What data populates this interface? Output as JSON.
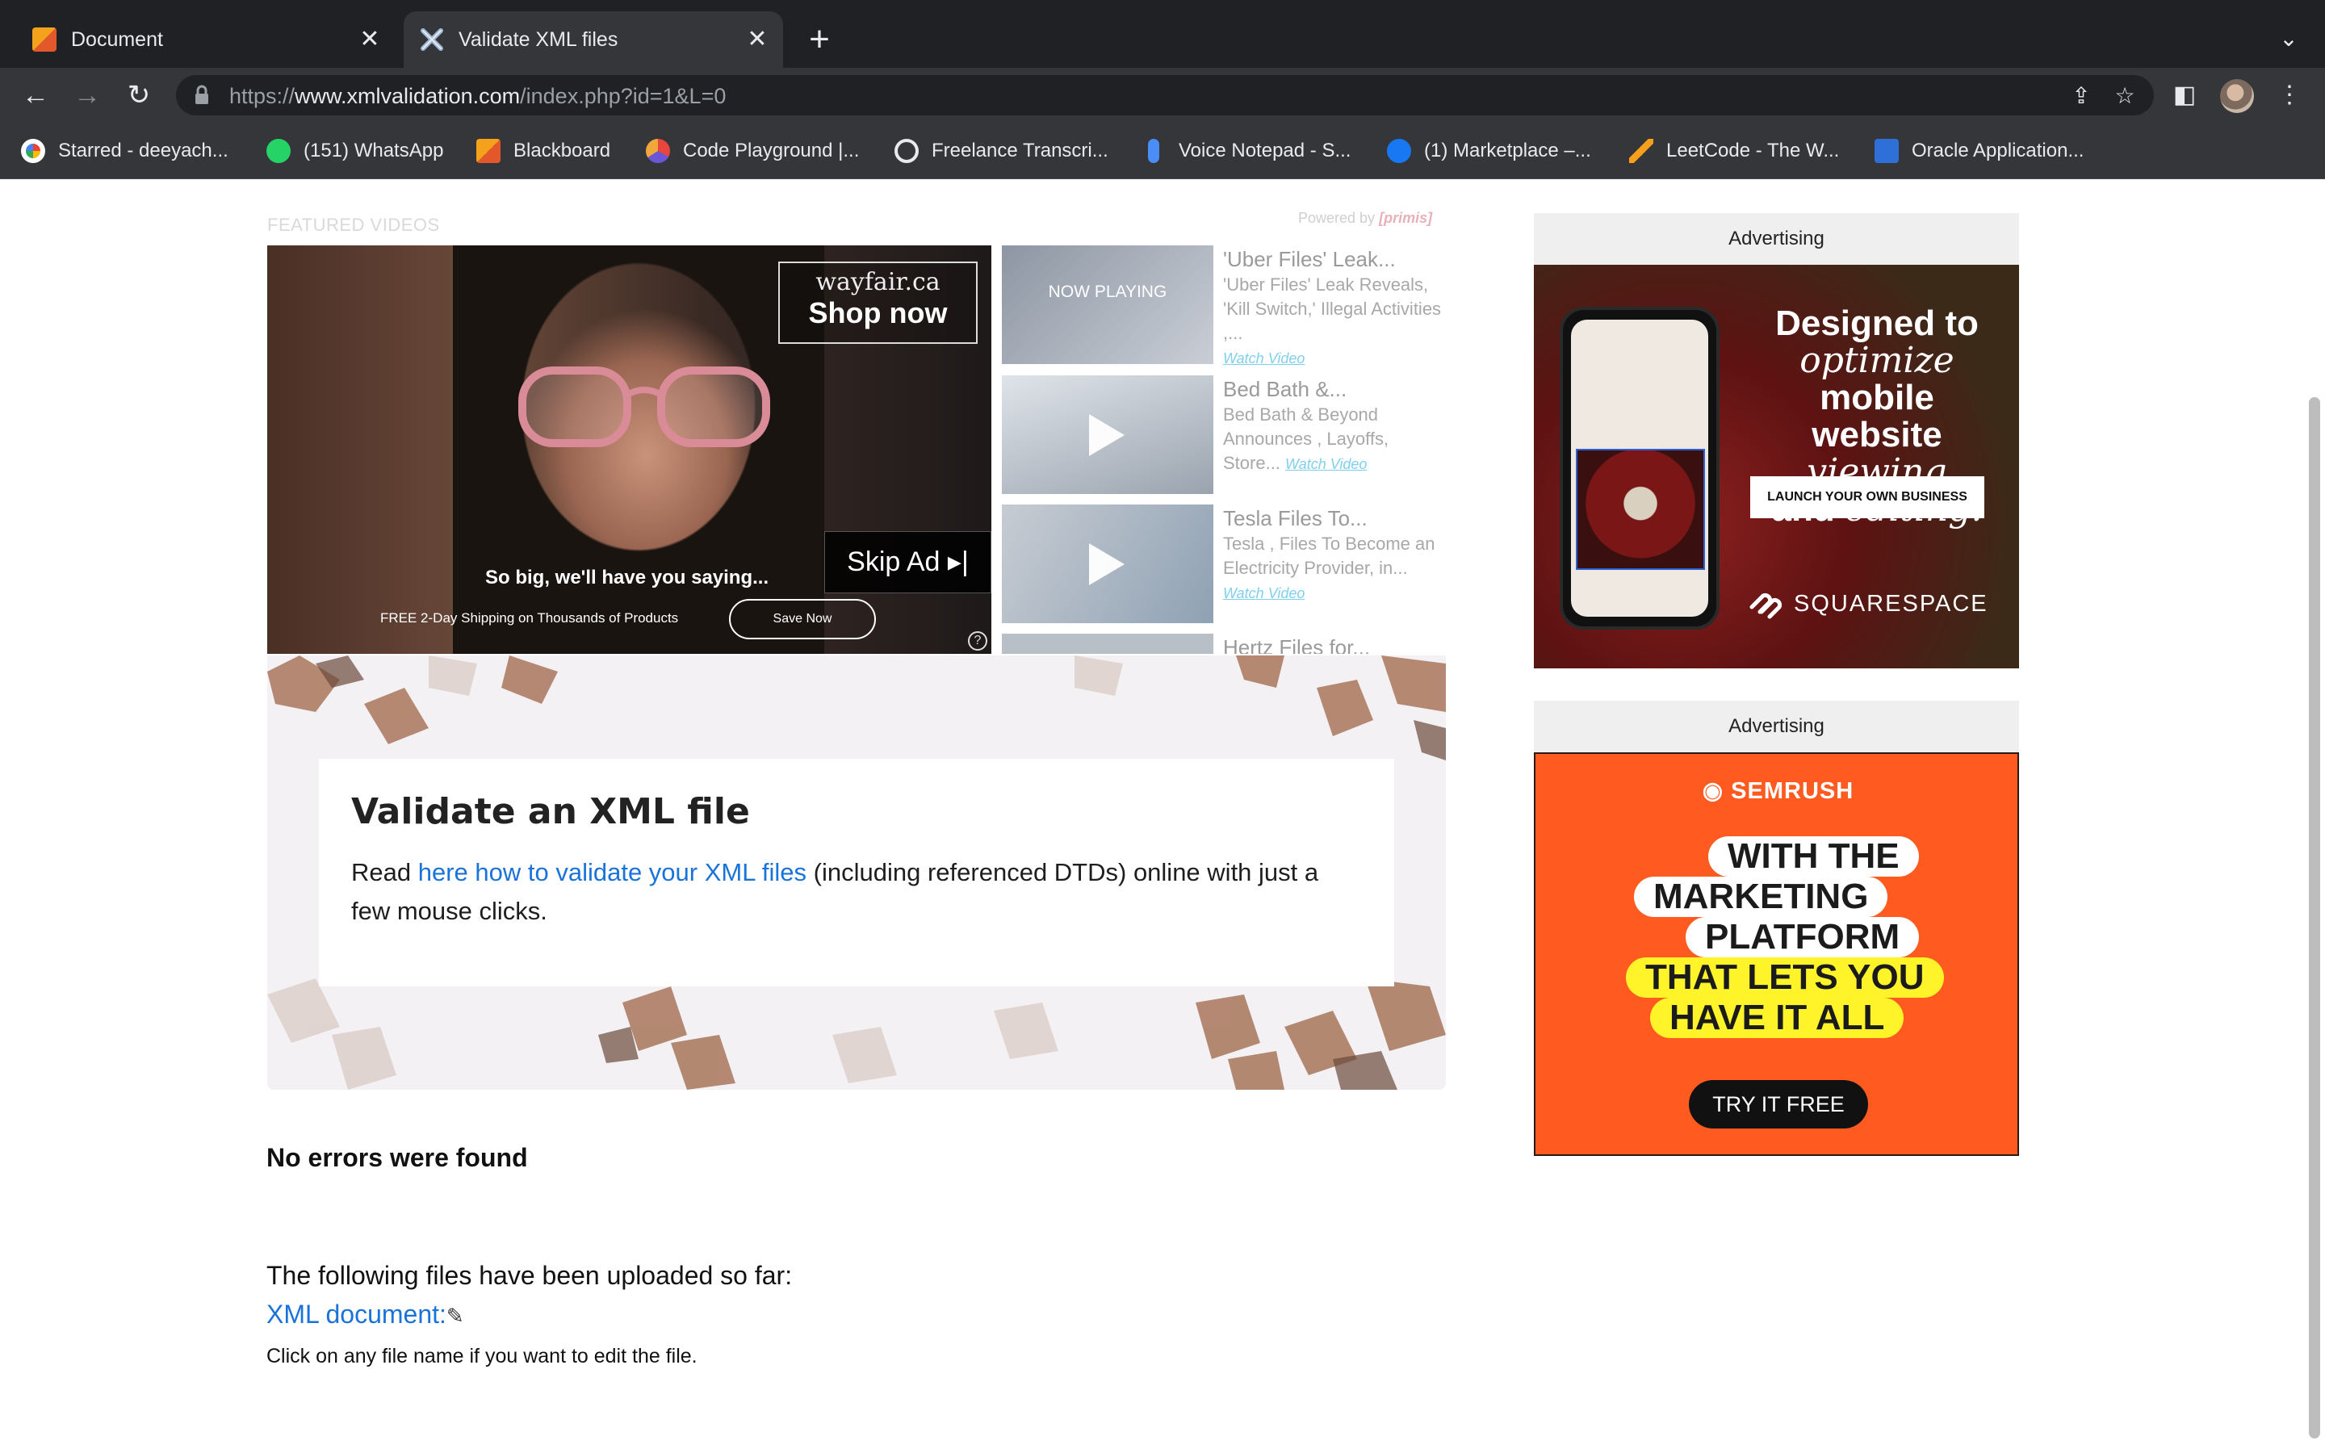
{
  "browser": {
    "tabs": [
      {
        "title": "Document",
        "active": false
      },
      {
        "title": "Validate XML files",
        "active": true
      }
    ],
    "url": {
      "prefix": "https://",
      "host": "www.xmlvalidation.com",
      "path": "/index.php?id=1&L=0"
    },
    "bookmarks": [
      "Starred - deeyach...",
      "(151) WhatsApp",
      "Blackboard",
      "Code Playground |...",
      "Freelance Transcri...",
      "Voice Notepad - S...",
      "(1) Marketplace –...",
      "LeetCode - The W...",
      "Oracle Application..."
    ]
  },
  "video_player": {
    "section_label": "FEATURED VIDEOS",
    "powered_by": "Powered by",
    "powered_brand": "[primis]",
    "ad": {
      "brand": "wayfair.ca",
      "cta": "Shop now",
      "tagline": "So big, we'll have you saying...",
      "shipping": "FREE 2-Day Shipping on Thousands of Products",
      "save_button": "Save Now",
      "skip_button": "Skip Ad"
    },
    "playlist": [
      {
        "title": "'Uber Files' Leak...",
        "description": "'Uber Files' Leak Reveals, 'Kill Switch,' Illegal Activities ,...",
        "watch": "Watch Video",
        "now_playing": "NOW PLAYING"
      },
      {
        "title": "Bed Bath &...",
        "description": "Bed Bath & Beyond Announces , Layoffs, Store...",
        "watch": "Watch Video"
      },
      {
        "title": "Tesla Files To...",
        "description": "Tesla , Files To Become an Electricity Provider, in...",
        "watch": "Watch Video"
      },
      {
        "title": "Hertz Files for..."
      }
    ]
  },
  "hero": {
    "title": "Validate an XML file",
    "text_before": "Read ",
    "link_text": "here how to validate your XML files",
    "text_after": " (including referenced DTDs) online with just a few mouse clicks."
  },
  "results": {
    "status": "No errors were found",
    "uploaded_label": "The following files have been uploaded so far:",
    "file_link": "XML document:",
    "hint": "Click on any file name if you want to edit the file."
  },
  "ads": [
    {
      "header": "Advertising",
      "advertiser": "SQUARESPACE",
      "headline_parts": [
        "Designed to",
        "optimize",
        "mobile website",
        "viewing",
        "and",
        "editing."
      ],
      "button": "LAUNCH YOUR OWN BUSINESS"
    },
    {
      "header": "Advertising",
      "advertiser": "SEMRUSH",
      "lines": [
        "WITH THE",
        "MARKETING",
        "PLATFORM",
        "THAT LETS YOU",
        "HAVE IT ALL"
      ],
      "button": "TRY IT FREE"
    }
  ],
  "colors": {
    "link": "#1a73d9",
    "semrush_orange": "#ff5a1f",
    "highlight_yellow": "#fff42a"
  }
}
